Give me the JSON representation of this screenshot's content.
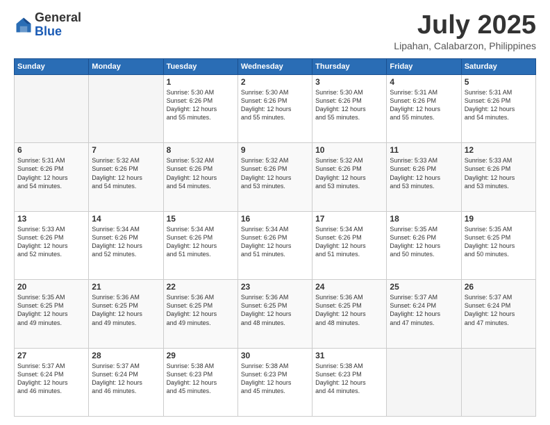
{
  "header": {
    "logo_general": "General",
    "logo_blue": "Blue",
    "month_title": "July 2025",
    "location": "Lipahan, Calabarzon, Philippines"
  },
  "days_of_week": [
    "Sunday",
    "Monday",
    "Tuesday",
    "Wednesday",
    "Thursday",
    "Friday",
    "Saturday"
  ],
  "weeks": [
    {
      "days": [
        {
          "num": "",
          "info": ""
        },
        {
          "num": "",
          "info": ""
        },
        {
          "num": "1",
          "info": "Sunrise: 5:30 AM\nSunset: 6:26 PM\nDaylight: 12 hours\nand 55 minutes."
        },
        {
          "num": "2",
          "info": "Sunrise: 5:30 AM\nSunset: 6:26 PM\nDaylight: 12 hours\nand 55 minutes."
        },
        {
          "num": "3",
          "info": "Sunrise: 5:30 AM\nSunset: 6:26 PM\nDaylight: 12 hours\nand 55 minutes."
        },
        {
          "num": "4",
          "info": "Sunrise: 5:31 AM\nSunset: 6:26 PM\nDaylight: 12 hours\nand 55 minutes."
        },
        {
          "num": "5",
          "info": "Sunrise: 5:31 AM\nSunset: 6:26 PM\nDaylight: 12 hours\nand 54 minutes."
        }
      ]
    },
    {
      "days": [
        {
          "num": "6",
          "info": "Sunrise: 5:31 AM\nSunset: 6:26 PM\nDaylight: 12 hours\nand 54 minutes."
        },
        {
          "num": "7",
          "info": "Sunrise: 5:32 AM\nSunset: 6:26 PM\nDaylight: 12 hours\nand 54 minutes."
        },
        {
          "num": "8",
          "info": "Sunrise: 5:32 AM\nSunset: 6:26 PM\nDaylight: 12 hours\nand 54 minutes."
        },
        {
          "num": "9",
          "info": "Sunrise: 5:32 AM\nSunset: 6:26 PM\nDaylight: 12 hours\nand 53 minutes."
        },
        {
          "num": "10",
          "info": "Sunrise: 5:32 AM\nSunset: 6:26 PM\nDaylight: 12 hours\nand 53 minutes."
        },
        {
          "num": "11",
          "info": "Sunrise: 5:33 AM\nSunset: 6:26 PM\nDaylight: 12 hours\nand 53 minutes."
        },
        {
          "num": "12",
          "info": "Sunrise: 5:33 AM\nSunset: 6:26 PM\nDaylight: 12 hours\nand 53 minutes."
        }
      ]
    },
    {
      "days": [
        {
          "num": "13",
          "info": "Sunrise: 5:33 AM\nSunset: 6:26 PM\nDaylight: 12 hours\nand 52 minutes."
        },
        {
          "num": "14",
          "info": "Sunrise: 5:34 AM\nSunset: 6:26 PM\nDaylight: 12 hours\nand 52 minutes."
        },
        {
          "num": "15",
          "info": "Sunrise: 5:34 AM\nSunset: 6:26 PM\nDaylight: 12 hours\nand 51 minutes."
        },
        {
          "num": "16",
          "info": "Sunrise: 5:34 AM\nSunset: 6:26 PM\nDaylight: 12 hours\nand 51 minutes."
        },
        {
          "num": "17",
          "info": "Sunrise: 5:34 AM\nSunset: 6:26 PM\nDaylight: 12 hours\nand 51 minutes."
        },
        {
          "num": "18",
          "info": "Sunrise: 5:35 AM\nSunset: 6:26 PM\nDaylight: 12 hours\nand 50 minutes."
        },
        {
          "num": "19",
          "info": "Sunrise: 5:35 AM\nSunset: 6:25 PM\nDaylight: 12 hours\nand 50 minutes."
        }
      ]
    },
    {
      "days": [
        {
          "num": "20",
          "info": "Sunrise: 5:35 AM\nSunset: 6:25 PM\nDaylight: 12 hours\nand 49 minutes."
        },
        {
          "num": "21",
          "info": "Sunrise: 5:36 AM\nSunset: 6:25 PM\nDaylight: 12 hours\nand 49 minutes."
        },
        {
          "num": "22",
          "info": "Sunrise: 5:36 AM\nSunset: 6:25 PM\nDaylight: 12 hours\nand 49 minutes."
        },
        {
          "num": "23",
          "info": "Sunrise: 5:36 AM\nSunset: 6:25 PM\nDaylight: 12 hours\nand 48 minutes."
        },
        {
          "num": "24",
          "info": "Sunrise: 5:36 AM\nSunset: 6:25 PM\nDaylight: 12 hours\nand 48 minutes."
        },
        {
          "num": "25",
          "info": "Sunrise: 5:37 AM\nSunset: 6:24 PM\nDaylight: 12 hours\nand 47 minutes."
        },
        {
          "num": "26",
          "info": "Sunrise: 5:37 AM\nSunset: 6:24 PM\nDaylight: 12 hours\nand 47 minutes."
        }
      ]
    },
    {
      "days": [
        {
          "num": "27",
          "info": "Sunrise: 5:37 AM\nSunset: 6:24 PM\nDaylight: 12 hours\nand 46 minutes."
        },
        {
          "num": "28",
          "info": "Sunrise: 5:37 AM\nSunset: 6:24 PM\nDaylight: 12 hours\nand 46 minutes."
        },
        {
          "num": "29",
          "info": "Sunrise: 5:38 AM\nSunset: 6:23 PM\nDaylight: 12 hours\nand 45 minutes."
        },
        {
          "num": "30",
          "info": "Sunrise: 5:38 AM\nSunset: 6:23 PM\nDaylight: 12 hours\nand 45 minutes."
        },
        {
          "num": "31",
          "info": "Sunrise: 5:38 AM\nSunset: 6:23 PM\nDaylight: 12 hours\nand 44 minutes."
        },
        {
          "num": "",
          "info": ""
        },
        {
          "num": "",
          "info": ""
        }
      ]
    }
  ]
}
